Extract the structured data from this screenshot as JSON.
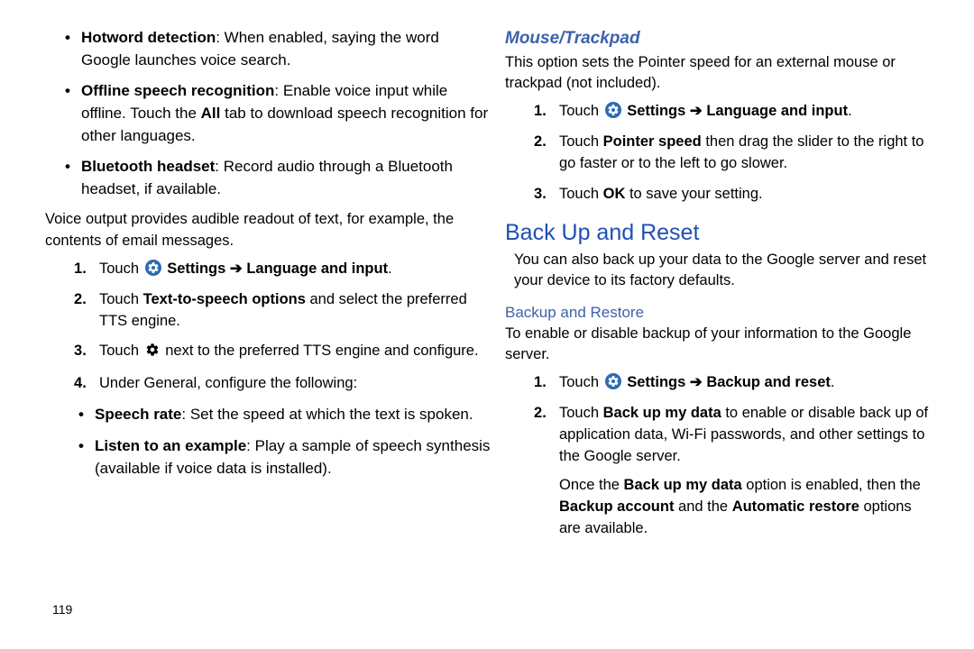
{
  "left": {
    "bullets1": [
      {
        "term": "Hotword detection",
        "rest": ": When enabled, saying the word Google launches voice search."
      },
      {
        "term": "Offline speech recognition",
        "rest": ": Enable voice input while offline. Touch the ",
        "mid_bold": "All",
        "rest2": " tab to download speech recognition for other languages."
      },
      {
        "term": "Bluetooth headset",
        "rest": ": Record audio through a Bluetooth headset, if available."
      }
    ],
    "para1": "Voice output provides audible readout of text, for example, the contents of email messages.",
    "steps1": {
      "s1_pre": "Touch ",
      "s1_settings": "Settings ",
      "s1_arrow": "➔ ",
      "s1_post": "Language and input",
      "s1_end": ".",
      "s2_pre": "Touch ",
      "s2_bold": "Text-to-speech options",
      "s2_post": " and select the preferred TTS engine.",
      "s3_pre": "Touch ",
      "s3_post": " next to the preferred TTS engine and configure.",
      "s4": "Under General, configure the following:"
    },
    "bullets2": [
      {
        "term": "Speech rate",
        "rest": ": Set the speed at which the text is spoken."
      },
      {
        "term": "Listen to an example",
        "rest": ": Play a sample of speech synthesis (available if voice data is installed)."
      }
    ]
  },
  "right": {
    "section1_title": "Mouse/Trackpad",
    "section1_para": "This option sets the Pointer speed for an external mouse or trackpad (not included).",
    "steps_a": {
      "s1_pre": "Touch ",
      "s1_settings": "Settings ",
      "s1_arrow": "➔ ",
      "s1_post": "Language and input",
      "s1_end": ".",
      "s2_pre": "Touch ",
      "s2_bold": "Pointer speed",
      "s2_post": " then drag the slider to the right to go faster or to the left to go slower.",
      "s3_pre": "Touch ",
      "s3_bold": "OK",
      "s3_post": " to save your setting."
    },
    "section2_title": "Back Up and Reset",
    "section2_para": "You can also back up your data to the Google server and reset your device to its factory defaults.",
    "subhead": "Backup and Restore",
    "para2": "To enable or disable backup of your information to the Google server.",
    "steps_b": {
      "s1_pre": "Touch ",
      "s1_settings": "Settings ",
      "s1_arrow": "➔ ",
      "s1_post": "Backup and reset",
      "s1_end": ".",
      "s2_pre": "Touch ",
      "s2_bold": "Back up my data",
      "s2_post": " to enable or disable back up of application data, Wi-Fi passwords, and other settings to the Google server.",
      "s2_extra_pre": "Once the ",
      "s2_extra_b1": "Back up my data",
      "s2_extra_mid": " option is enabled, then the ",
      "s2_extra_b2": "Backup account",
      "s2_extra_mid2": " and the ",
      "s2_extra_b3": "Automatic restore",
      "s2_extra_end": " options are available."
    }
  },
  "page_number": "119"
}
